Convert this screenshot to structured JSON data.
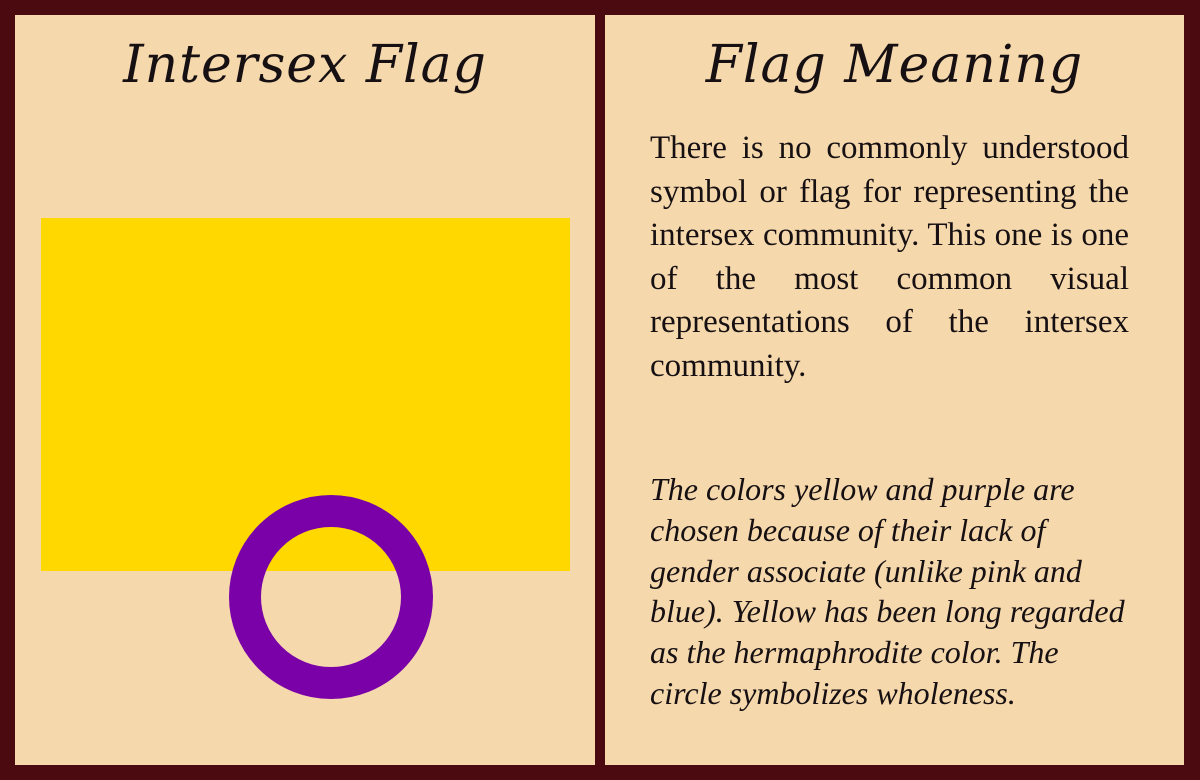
{
  "left_panel": {
    "title": "Intersex Flag",
    "flag": {
      "field_color": "#ffd800",
      "ring_color": "#7a00a8",
      "icon": "intersex-flag-ring"
    }
  },
  "right_panel": {
    "title": "Flag Meaning",
    "meaning": "There is no commonly understood symbol or flag for representing the intersex community. This one is one of the most common visual representations of the intersex community.",
    "note": "The colors yellow and purple are chosen because of their lack of gender associate (unlike pink and blue). Yellow has been long regarded as the hermaphrodite color. The circle symbolizes wholeness."
  },
  "colors": {
    "border": "#4a0a0f",
    "panel": "#f6d8ad",
    "text": "#161012"
  }
}
